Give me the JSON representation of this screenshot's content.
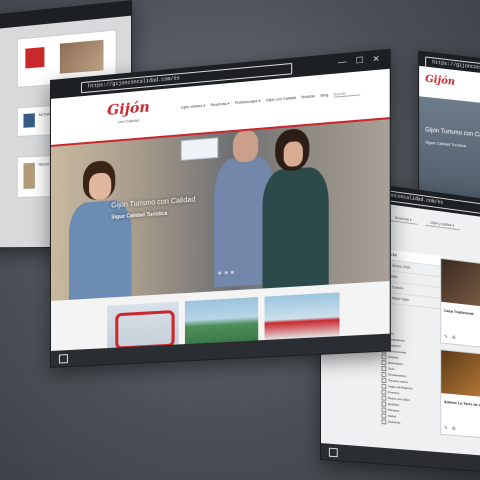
{
  "main": {
    "url": "https://gijonconcalidad.com/es",
    "window_controls": "— ☐ ✕",
    "logo_script": "Gijón",
    "logo_sub": "con Calidad",
    "nav": [
      "Gijón Verano ▾",
      "Reservas ▾",
      "Profesionales ▾",
      "Gijón con Calidad",
      "Noticias",
      "Blog"
    ],
    "search_placeholder": "Buscar",
    "hero_title": "Gijón Turismo con Calidad",
    "hero_subtitle": "Sigue Calidad Turística"
  },
  "left": {
    "url": "…",
    "items": [
      {
        "label": "ACTIVIDADES EMPRESAS"
      },
      {
        "label": "RESULTADOS CALENDARIO"
      }
    ],
    "button": "VER"
  },
  "right_top": {
    "url": "https://gijonconcalidad.com/es",
    "logo_script": "Gijón",
    "heading": "Gijón Turismo con Calidad",
    "sub": "Sigue Calidad Turística"
  },
  "right": {
    "url": "https://gijonconcalidad.com/es",
    "tabs": [
      "Reservas ▾",
      "Gijón y cultura ▾"
    ],
    "sidebar": [
      "Gijón En",
      "Gijón Verano 2020",
      "Accesible",
      "Gijón Turismo",
      "Calle Mayor Gijón"
    ],
    "filters": [
      "Arte",
      "Alojamiento",
      "Espacios",
      "Gastronomía",
      "Hoteles",
      "Naturaleza",
      "Ocio",
      "Restaurantes",
      "Turismo activo",
      "Viajes de Negocio",
      "Eventos",
      "Rutas por Gijón",
      "Bebidas",
      "Parques",
      "Salud",
      "Sidrerías"
    ],
    "card1_title": "Casa Tradicional",
    "card2_title": "Admire La Torre de la Ícoa"
  }
}
